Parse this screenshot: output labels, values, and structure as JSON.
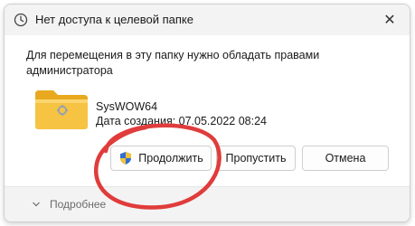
{
  "dialog": {
    "title": "Нет доступа к целевой папке",
    "close_glyph": "✕",
    "message": "Для перемещения в эту папку нужно обладать правами администратора"
  },
  "file": {
    "icon": "folder-icon",
    "name": "SysWOW64",
    "date_text": "Дата создания: 07.05.2022 08:24"
  },
  "buttons": {
    "continue_label": "Продолжить",
    "skip_label": "Пропустить",
    "cancel_label": "Отмена"
  },
  "footer": {
    "details_label": "Подробнее"
  },
  "colors": {
    "annotation": "#e03c3c",
    "folder": "#f6c343"
  }
}
